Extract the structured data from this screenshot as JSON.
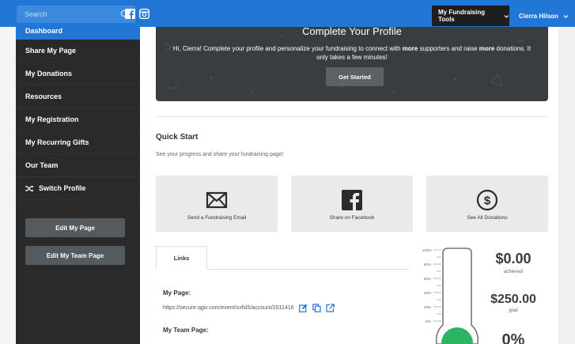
{
  "header": {
    "search_placeholder": "Search",
    "tools_label": "My Fundraising Tools",
    "user_name": "Cierra Hilson"
  },
  "sidebar": {
    "items": [
      {
        "label": "Dashboard"
      },
      {
        "label": "Share My Page"
      },
      {
        "label": "My Donations"
      },
      {
        "label": "Resources"
      },
      {
        "label": "My Registration"
      },
      {
        "label": "My Recurring Gifts"
      },
      {
        "label": "Our Team"
      },
      {
        "label": "Switch Profile"
      }
    ],
    "edit_page_label": "Edit My Page",
    "edit_team_label": "Edit My Team Page"
  },
  "banner": {
    "title": "Complete Your Profile",
    "text_1": "Hi, Cierra! Complete your profile and personalize your fundraising to connect with ",
    "text_bold_1": "more",
    "text_2": " supporters and raise ",
    "text_bold_2": "more",
    "text_3": " donations. It only takes a few minutes!",
    "button": "Get Started"
  },
  "quick_start": {
    "title": "Quick Start",
    "subtitle": "See your progress and share your fundraising page!",
    "cards": [
      {
        "label": "Send a Fundraising Email"
      },
      {
        "label": "Share on Facebook"
      },
      {
        "label": "See All Donations"
      }
    ]
  },
  "links": {
    "tab_label": "Links",
    "my_page_label": "My Page:",
    "my_page_url": "https://secure.qgiv.com/event/xxfsl5/account/2011416",
    "team_page_label": "My Team Page:"
  },
  "progress": {
    "ticks": [
      "100%",
      "80%",
      "60%",
      "40%",
      "20%",
      "0%"
    ],
    "achieved_value": "$0.00",
    "achieved_label": "achieved",
    "goal_value": "$250.00",
    "goal_label": "goal",
    "percent_value": "0%",
    "fill_fraction": 0,
    "accent": "#2db463"
  },
  "colors": {
    "primary": "#2176d6",
    "sidebar": "#2a2a2a",
    "banner": "#3a3d40"
  }
}
